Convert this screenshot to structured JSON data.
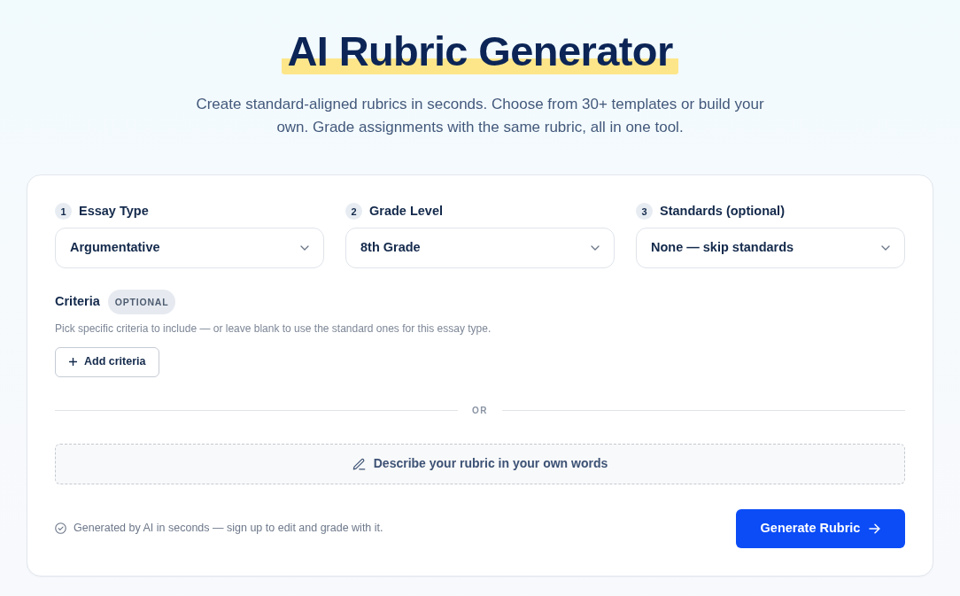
{
  "header": {
    "title": "AI Rubric Generator",
    "subtitle": "Create standard-aligned rubrics in seconds. Choose from 30+ templates or build your own. Grade assignments with the same rubric, all in one tool."
  },
  "form": {
    "fields": [
      {
        "step": "1",
        "label": "Essay Type",
        "value": "Argumentative"
      },
      {
        "step": "2",
        "label": "Grade Level",
        "value": "8th Grade"
      },
      {
        "step": "3",
        "label": "Standards (optional)",
        "value": "None — skip standards"
      }
    ],
    "criteria": {
      "label": "Criteria",
      "badge": "OPTIONAL",
      "help": "Pick specific criteria to include — or leave blank to use the standard ones for this essay type.",
      "add_button": "Add criteria"
    },
    "divider": "OR",
    "describe_button": "Describe your rubric in your own words",
    "footer_note": "Generated by AI in seconds — sign up to edit and grade with it.",
    "generate_button": "Generate Rubric"
  }
}
